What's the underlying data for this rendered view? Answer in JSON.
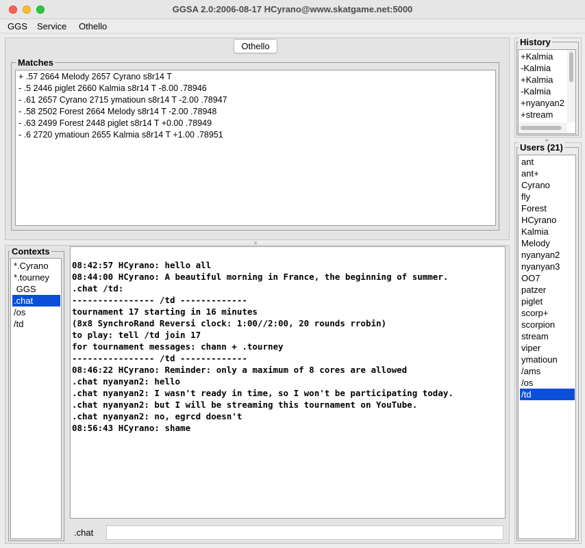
{
  "window": {
    "title": "GGSA 2.0:2006-08-17 HCyrano@www.skatgame.net:5000"
  },
  "menu": {
    "items": [
      "GGS",
      "Service",
      "Othello"
    ]
  },
  "tab": {
    "label": "Othello"
  },
  "matches": {
    "legend": "Matches",
    "rows": [
      "+ .57 2664 Melody 2657 Cyrano s8r14 T",
      "- .5 2446 piglet 2660 Kalmia s8r14 T -8.00  .78946",
      "- .61 2657 Cyrano 2715 ymatioun s8r14 T -2.00  .78947",
      "- .58 2502 Forest 2664 Melody s8r14 T -2.00  .78948",
      "- .63 2499 Forest 2448 piglet s8r14 T +0.00  .78949",
      "- .6 2720 ymatioun 2655 Kalmia s8r14 T +1.00  .78951"
    ]
  },
  "contexts": {
    "legend": "Contexts",
    "items": [
      "*.Cyrano",
      "*.tourney",
      " GGS",
      ".chat",
      "/os",
      "/td"
    ],
    "selected_index": 3
  },
  "chat": {
    "lines": [
      "08:42:57 HCyrano: hello all",
      "08:44:00 HCyrano: A beautiful morning in France, the beginning of summer.",
      ".chat /td:",
      "---------------- /td -------------",
      "tournament 17 starting in 16 minutes",
      "(8x8 SynchroRand Reversi clock: 1:00//2:00, 20 rounds rrobin)",
      "to play: tell /td join 17",
      "for tournament messages: chann + .tourney",
      "---------------- /td -------------",
      "08:46:22 HCyrano: Reminder: only a maximum of 8 cores are allowed",
      ".chat nyanyan2: hello",
      ".chat nyanyan2: I wasn't ready in time, so I won't be participating today.",
      ".chat nyanyan2: but I will be streaming this tournament on YouTube.",
      ".chat nyanyan2: no, egrcd doesn't",
      "08:56:43 HCyrano: shame"
    ],
    "input_prefix": ".chat",
    "input_value": ""
  },
  "history": {
    "legend": "History",
    "items": [
      "+Kalmia",
      "-Kalmia",
      "+Kalmia",
      "-Kalmia",
      "+nyanyan2",
      "+stream"
    ]
  },
  "users": {
    "legend": "Users (21)",
    "items": [
      "ant",
      "ant+",
      "Cyrano",
      "fly",
      "Forest",
      "HCyrano",
      "Kalmia",
      "Melody",
      "nyanyan2",
      "nyanyan3",
      "OO7",
      "patzer",
      "piglet",
      "scorp+",
      "scorpion",
      "stream",
      "viper",
      "ymatioun",
      "/ams",
      "/os",
      "/td"
    ],
    "selected_index": 20
  },
  "colors": {
    "selection": "#0b4fd8",
    "close": "#ff5f57",
    "minimize": "#febc2e",
    "maximize": "#28c840"
  }
}
